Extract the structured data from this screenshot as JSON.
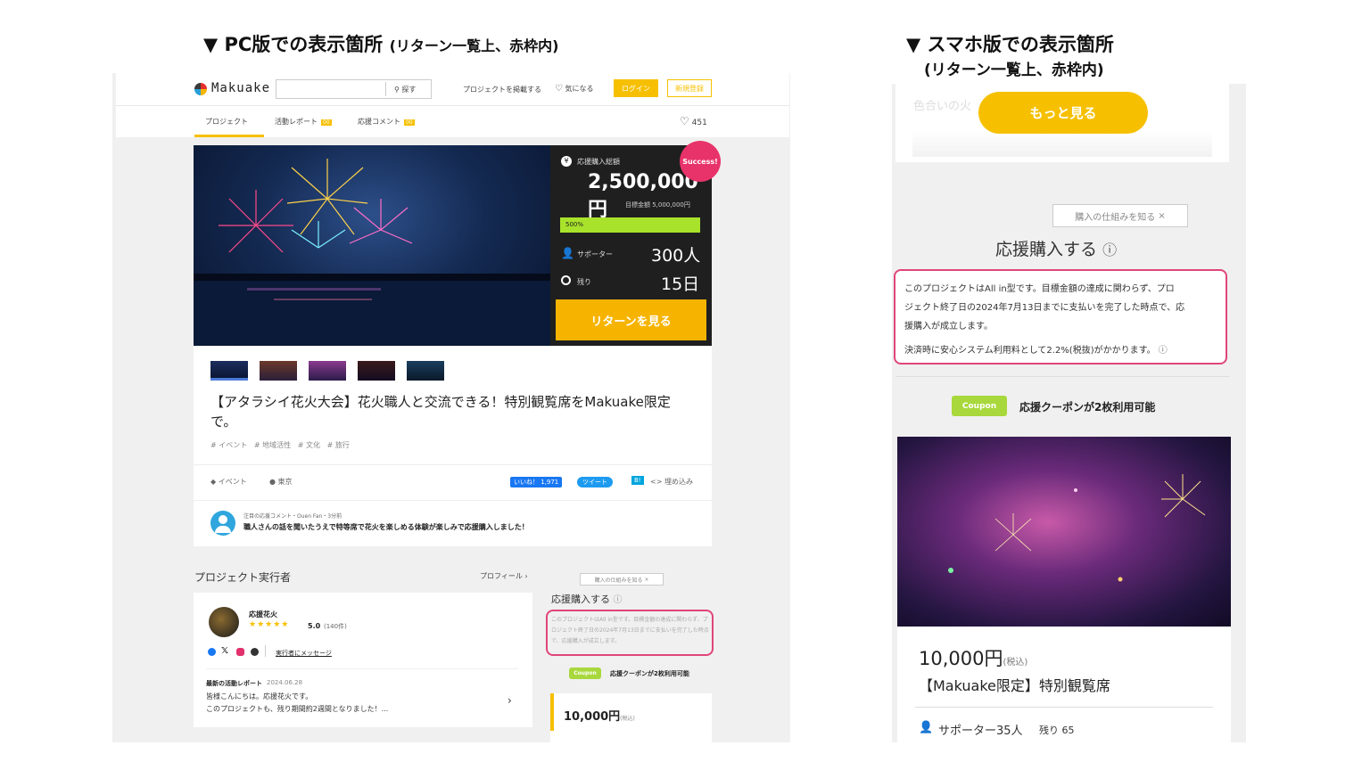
{
  "captions": {
    "pc_main": "▼ PC版での表示箇所",
    "pc_sub": "(リターン一覧上、赤枠内)",
    "mobile_main": "▼ スマホ版での表示箇所",
    "mobile_sub": "(リターン一覧上、赤枠内)"
  },
  "pc": {
    "header": {
      "logo": "Makuake",
      "search_button": "探す",
      "post_project": "プロジェクトを掲載する",
      "favorites": "気になる",
      "login": "ログイン",
      "register": "新規登録"
    },
    "tabs": [
      {
        "label": "プロジェクト"
      },
      {
        "label": "活動レポート",
        "badge": "00"
      },
      {
        "label": "応援コメント",
        "badge": "00"
      }
    ],
    "like_count": "451",
    "stats": {
      "total_label": "応援購入総額",
      "total_amount": "2,500,000円",
      "goal": "目標金額 5,000,000円",
      "progress_label": "500%",
      "progress_percent": 500,
      "success_badge": "Success!",
      "supporters_label": "サポーター",
      "supporters_value": "300人",
      "remaining_label": "残り",
      "remaining_value": "15日",
      "returns_button": "リターンを見る"
    },
    "title": "【アタラシイ花火大会】花火職人と交流できる！特別観覧席をMakuake限定で。",
    "tags": [
      "# イベント",
      "# 地域活性",
      "# 文化",
      "# 旅行"
    ],
    "meta": {
      "category": "イベント",
      "location": "東京",
      "like_button": "いいね！ 1,971",
      "tweet_button": "ツイート",
      "hatena": "B!",
      "embed": "埋め込み"
    },
    "comment": {
      "meta": "注目の応援コメント・Ouen Fan・3分前",
      "text": "職人さんの話を聞いたうえで特等席で花火を楽しめる体験が楽しみで応援購入しました！"
    },
    "owner": {
      "heading": "プロジェクト実行者",
      "profile_link": "プロフィール",
      "name": "応援花火",
      "rating": "5.0",
      "reviews": "(140件)",
      "message_link": "実行者にメッセージ",
      "report_label": "最新の活動レポート",
      "report_date": "2024.06.28",
      "report_line1": "皆様こんにちは。応援花火です。",
      "report_line2": "このプロジェクトも、残り期間約2週間となりました！..."
    },
    "support": {
      "how_it_works": "購入の仕組みを知る",
      "heading": "応援購入する",
      "notice": "このプロジェクトはAll in型です。目標金額の達成に関わらず、プロジェクト終了日の2024年7月13日までに支払いを完了した時点で、応援購入が成立します。",
      "coupon_label": "Coupon",
      "coupon_text": "応援クーポンが2枚利用可能",
      "price": "10,000円",
      "tax": "(税込)"
    }
  },
  "mobile": {
    "faded_text1": "色合いの火",
    "more_button": "もっと見る",
    "how_it_works": "購入の仕組みを知る",
    "heading": "応援購入する",
    "notice_line1": "このプロジェクトはAll in型です。目標金額の達成に関わらず、プロ",
    "notice_line2": "ジェクト終了日の2024年7月13日までに支払いを完了した時点で、応",
    "notice_line3": "援購入が成立します。",
    "fee_line": "決済時に安心システム利用料として2.2%(税抜)がかかります。",
    "coupon_label": "Coupon",
    "coupon_text": "応援クーポンが2枚利用可能",
    "price": "10,000円",
    "tax": "(税込)",
    "reward_title": "【Makuake限定】特別観覧席",
    "supporters": "サポーター35人",
    "remaining": "残り 65"
  },
  "colors": {
    "brand_yellow": "#f6c000",
    "highlight_pink": "#e0457b",
    "success_pink": "#e8336a",
    "progress_green": "#a8e22b"
  }
}
